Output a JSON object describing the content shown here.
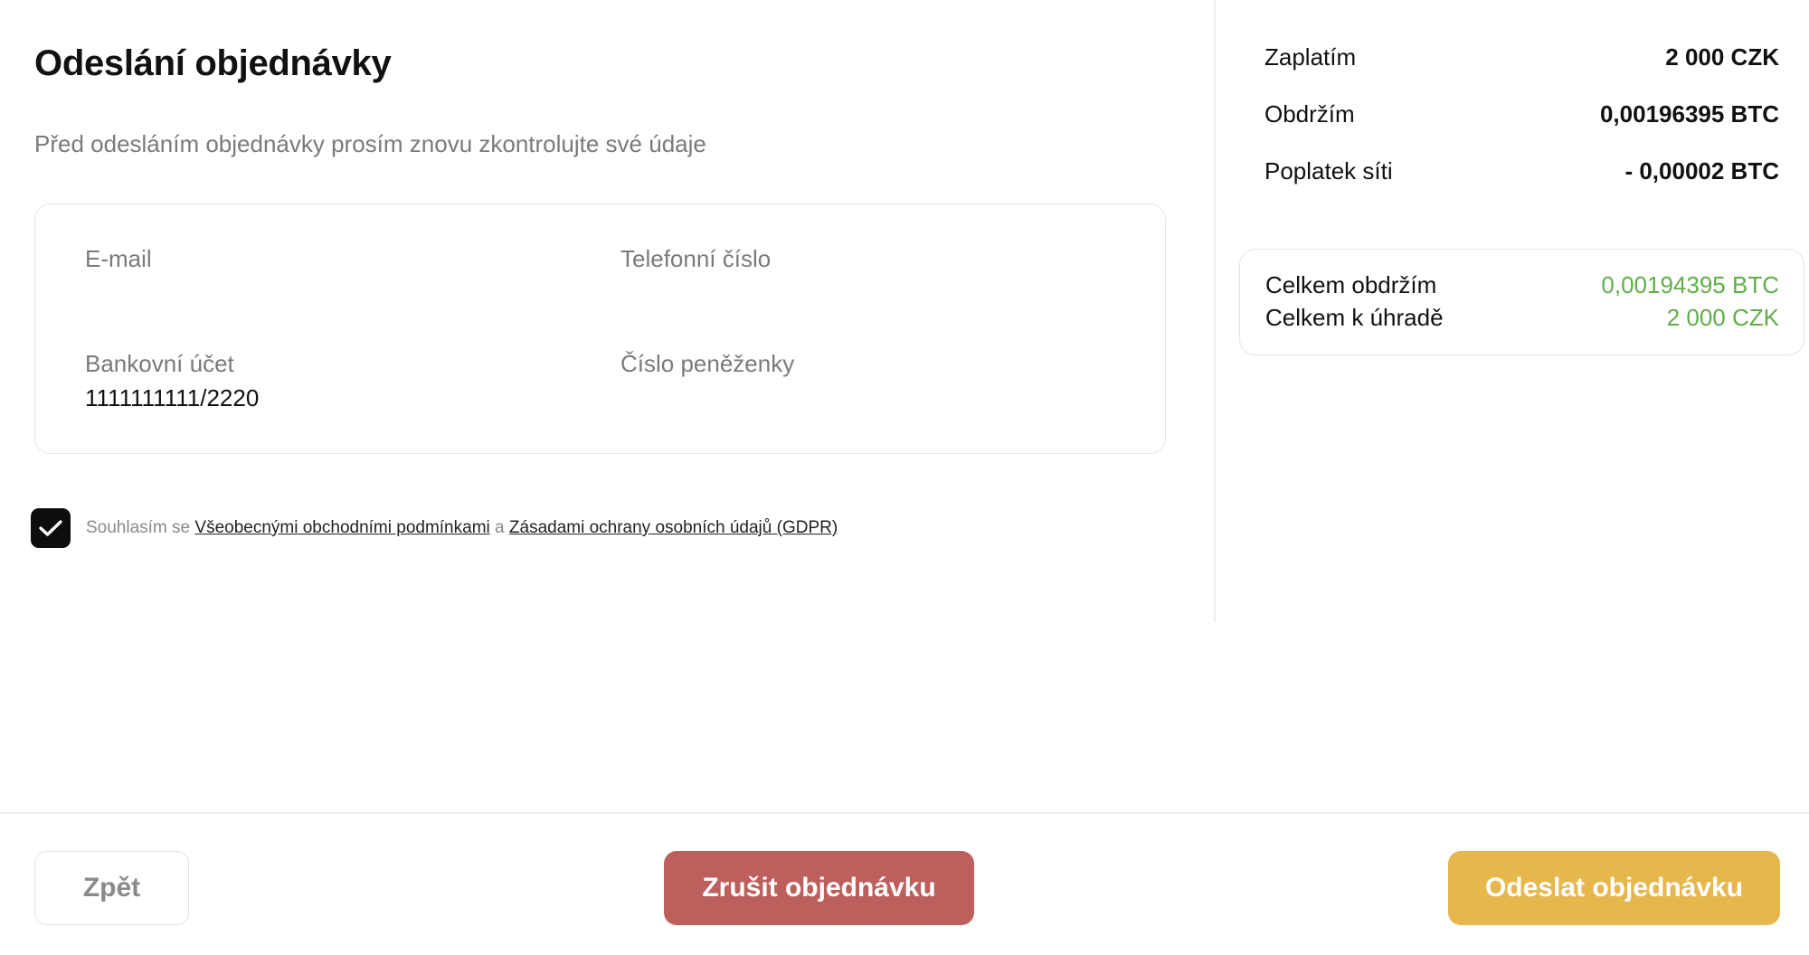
{
  "order": {
    "title": "Odeslání objednávky",
    "subtitle": "Před odesláním objednávky prosím znovu zkontrolujte své údaje",
    "fields": {
      "email": {
        "label": "E-mail",
        "value": ""
      },
      "phone": {
        "label": "Telefonní číslo",
        "value": ""
      },
      "bank": {
        "label": "Bankovní účet",
        "value": "1111111111/2220"
      },
      "wallet": {
        "label": "Číslo peněženky",
        "value": ""
      }
    },
    "consent": {
      "checked": true,
      "prefix": "Souhlasím se",
      "terms_link": "Všeobecnými obchodními podmínkami",
      "conjunction": "a",
      "gdpr_link": "Zásadami ochrany osobních údajů (GDPR)"
    }
  },
  "summary": {
    "rows": [
      {
        "label": "Zaplatím",
        "value": "2 000 CZK"
      },
      {
        "label": "Obdržím",
        "value": "0,00196395 BTC"
      },
      {
        "label": "Poplatek síti",
        "value": "- 0,00002 BTC"
      }
    ],
    "totals": [
      {
        "label": "Celkem obdržím",
        "value": "0,00194395 BTC"
      },
      {
        "label": "Celkem k úhradě",
        "value": "2 000 CZK"
      }
    ],
    "accent_color": "#5fae46"
  },
  "footer": {
    "back_label": "Zpět",
    "cancel_label": "Zrušit objednávku",
    "submit_label": "Odeslat objednávku",
    "cancel_color": "#bd5f5c",
    "submit_color": "#e5b74d"
  }
}
